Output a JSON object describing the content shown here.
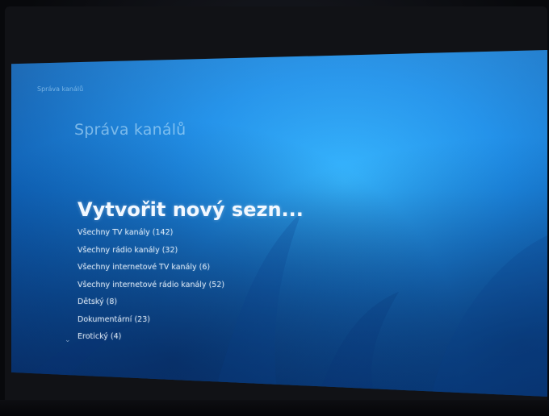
{
  "header": {
    "breadcrumb": "Správa kanálů",
    "corner_text": "",
    "page_title": "Správa kanálů"
  },
  "channel_lists": {
    "selected": "Vytvořit nový sezn...",
    "items": [
      "Všechny TV kanály (142)",
      "Všechny rádio kanály (32)",
      "Všechny internetové TV kanály (6)",
      "Všechny internetové rádio kanály (52)",
      "Dětský (8)",
      "Dokumentární (23)",
      "Erotický (4)"
    ]
  },
  "theme": {
    "screen_blue": "#1d8de8",
    "text_color": "#f2f8ff"
  }
}
